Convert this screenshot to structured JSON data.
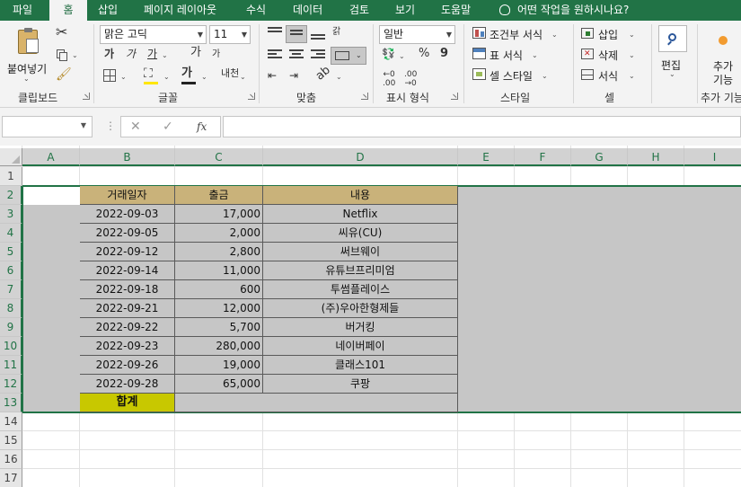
{
  "tabs": [
    "파일",
    "홈",
    "삽입",
    "페이지 레이아웃",
    "수식",
    "데이터",
    "검토",
    "보기",
    "도움말"
  ],
  "active_tab": "홈",
  "tell_me": "어떤 작업을 원하시나요?",
  "ribbon": {
    "clipboard": {
      "paste_label": "붙여넣기",
      "group_label": "클립보드"
    },
    "font": {
      "font_name": "맑은 고딕",
      "font_size": "11",
      "bold": "가",
      "italic": "가",
      "underline": "가",
      "grow": "가",
      "shrink": "가",
      "font_color_glyph": "가",
      "phonetic": "내천",
      "group_label": "글꼴"
    },
    "alignment": {
      "wrap_glyph": "갉",
      "group_label": "맞춤"
    },
    "number": {
      "format": "일반",
      "percent": "%",
      "comma": "9",
      "group_label": "표시 형식"
    },
    "styles": {
      "conditional": "조건부 서식",
      "table": "표 서식",
      "cell": "셀 스타일",
      "group_label": "스타일"
    },
    "cells": {
      "insert": "삽입",
      "delete": "삭제",
      "format": "서식",
      "group_label": "셀"
    },
    "editing": {
      "label": "편집"
    },
    "addins": {
      "label1": "추가",
      "label2": "기능",
      "group_label": "추가 기능"
    }
  },
  "formula_bar": {
    "cancel": "✕",
    "enter": "✓",
    "fx": "fx",
    "name_box": "",
    "value": ""
  },
  "grid": {
    "columns": [
      "A",
      "B",
      "C",
      "D",
      "E",
      "F",
      "G",
      "H",
      "I"
    ],
    "rows": [
      "1",
      "2",
      "3",
      "4",
      "5",
      "6",
      "7",
      "8",
      "9",
      "10",
      "11",
      "12",
      "13",
      "14",
      "15",
      "16",
      "17"
    ],
    "selected_rows": [
      "2",
      "3",
      "4",
      "5",
      "6",
      "7",
      "8",
      "9",
      "10",
      "11",
      "12",
      "13"
    ],
    "selected_columns": [
      "A",
      "B",
      "C",
      "D",
      "E",
      "F",
      "G",
      "H",
      "I"
    ]
  },
  "table": {
    "headers": [
      "거래일자",
      "출금",
      "내용"
    ],
    "rows": [
      [
        "2022-09-03",
        "17,000",
        "Netflix"
      ],
      [
        "2022-09-05",
        "2,000",
        "씨유(CU)"
      ],
      [
        "2022-09-12",
        "2,800",
        "써브웨이"
      ],
      [
        "2022-09-14",
        "11,000",
        "유튜브프리미엄"
      ],
      [
        "2022-09-18",
        "600",
        "투썸플레이스"
      ],
      [
        "2022-09-21",
        "12,000",
        "(주)우아한형제들"
      ],
      [
        "2022-09-22",
        "5,700",
        "버거킹"
      ],
      [
        "2022-09-23",
        "280,000",
        "네이버페이"
      ],
      [
        "2022-09-26",
        "19,000",
        "클래스101"
      ],
      [
        "2022-09-28",
        "65,000",
        "쿠팡"
      ]
    ],
    "total_label": "합계",
    "total_value": ""
  },
  "colors": {
    "title_bar": "#217346",
    "header_fill": "#c9b27a",
    "total_fill": "#c8c800",
    "selection_fill": "#c6c6c6",
    "selection_border": "#217346"
  }
}
